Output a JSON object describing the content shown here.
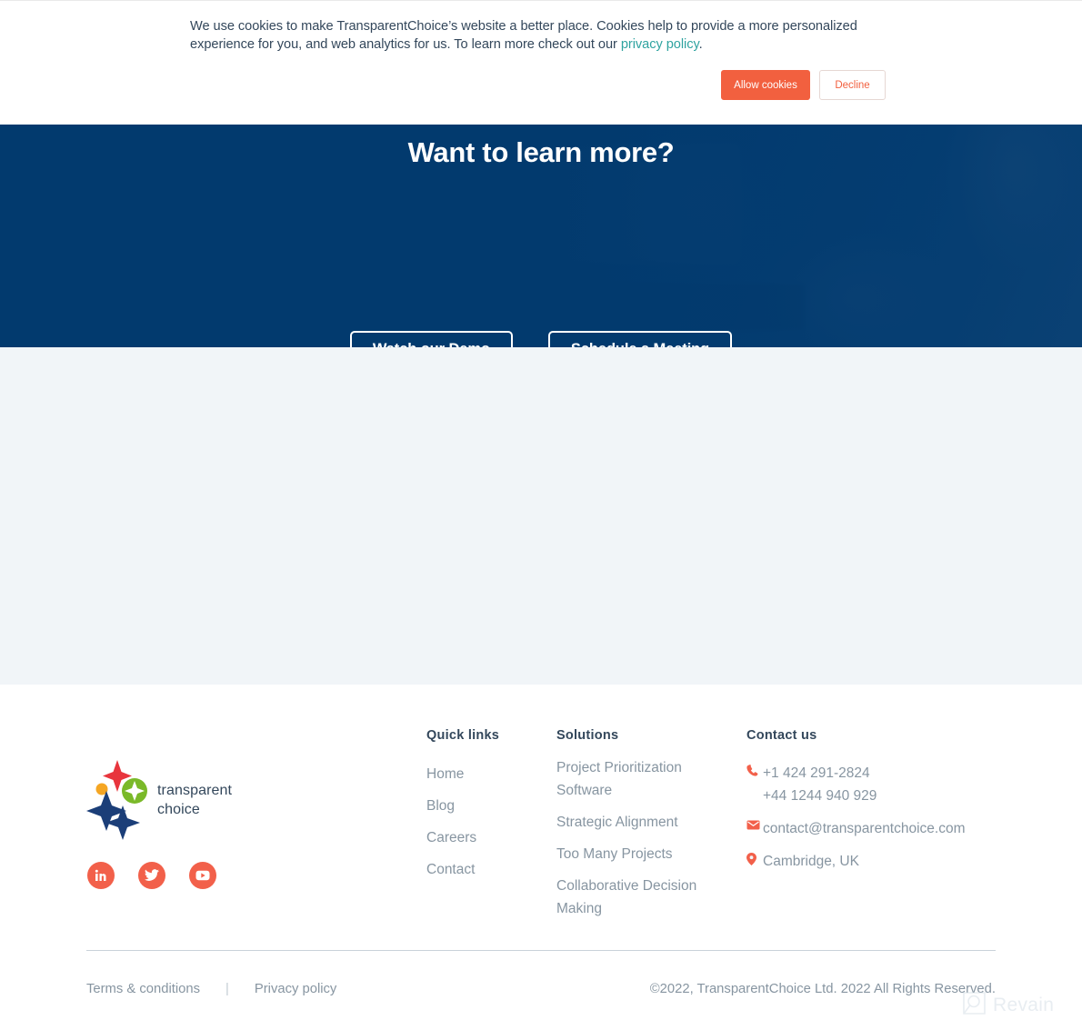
{
  "cookie_banner": {
    "text_part1": "We use cookies to make TransparentChoice’s website a better place. Cookies help to provide a more personalized experience for you, and web analytics for us. To learn more check out our ",
    "link_label": "privacy policy",
    "text_part2": ".",
    "allow_label": "Allow cookies",
    "decline_label": "Decline",
    "accent_color": "#f2603f",
    "link_color": "#2fa3a0"
  },
  "cta": {
    "title": "Want to learn more?",
    "buttons": [
      {
        "label": "Watch our Demo",
        "name": "watch-demo-button"
      },
      {
        "label": "Schedule a Meeting",
        "name": "schedule-meeting-button"
      }
    ],
    "background_color": "#023a6e"
  },
  "footer": {
    "logo": {
      "line1": "transparent",
      "line2": "choice",
      "colors": {
        "red_star": "#e8353d",
        "orange_dot": "#f5a623",
        "green_circle": "#7ab929",
        "navy_star": "#1b3e78"
      }
    },
    "socials": [
      {
        "name": "linkedin-icon",
        "label": "in"
      },
      {
        "name": "twitter-icon",
        "label": "twitter"
      },
      {
        "name": "youtube-icon",
        "label": "youtube"
      }
    ],
    "social_color": "#f2604a",
    "quick_links": {
      "heading": "Quick links",
      "items": [
        "Home",
        "Blog",
        "Careers",
        "Contact"
      ]
    },
    "solutions": {
      "heading": "Solutions",
      "items": [
        "Project Prioritization Software",
        "Strategic Alignment",
        "Too Many Projects",
        "Collaborative Decision Making"
      ]
    },
    "contact": {
      "heading": "Contact us",
      "phone_primary": "+1 424 291-2824",
      "phone_secondary": "+44 1244 940 929",
      "email": "contact@transparentchoice.com",
      "location": "Cambridge, UK",
      "icon_color": "#f2604a"
    },
    "legal": {
      "terms": "Terms & conditions",
      "separator": "|",
      "privacy": "Privacy policy"
    },
    "copyright": "©2022, TransparentChoice Ltd. 2022 All Rights Reserved.",
    "background_color": "#f1f5f8"
  },
  "watermark": {
    "label": "Revain"
  }
}
